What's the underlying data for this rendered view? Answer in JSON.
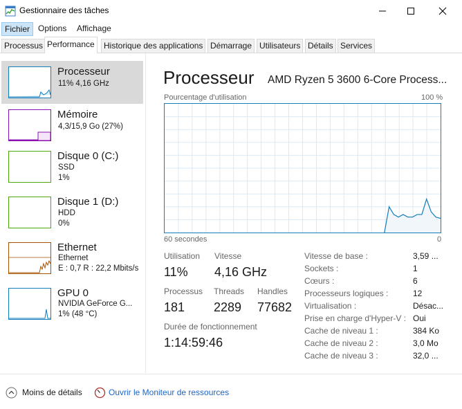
{
  "window": {
    "title": "Gestionnaire des tâches"
  },
  "menu": [
    "Fichier",
    "Options",
    "Affichage"
  ],
  "tabs": [
    "Processus",
    "Performance",
    "Historique des applications",
    "Démarrage",
    "Utilisateurs",
    "Détails",
    "Services"
  ],
  "active_tab": "Performance",
  "sidebar": {
    "items": [
      {
        "title": "Processeur",
        "sub1": "11% 4,16 GHz",
        "sub2": "",
        "color": "#117dbb"
      },
      {
        "title": "Mémoire",
        "sub1": "4,3/15,9 Go (27%)",
        "sub2": "",
        "color": "#8b12ae"
      },
      {
        "title": "Disque 0 (C:)",
        "sub1": "SSD",
        "sub2": "1%",
        "color": "#4da60c"
      },
      {
        "title": "Disque 1 (D:)",
        "sub1": "HDD",
        "sub2": "0%",
        "color": "#4da60c"
      },
      {
        "title": "Ethernet",
        "sub1": "Ethernet",
        "sub2": "E : 0,7 R : 22,2 Mbits/s",
        "color": "#a74f01"
      },
      {
        "title": "GPU 0",
        "sub1": "NVIDIA GeForce G...",
        "sub2": "1% (48 °C)",
        "color": "#117dbb"
      }
    ]
  },
  "main": {
    "title": "Processeur",
    "subtitle": "AMD Ryzen 5 3600 6-Core Process...",
    "graph_label": "Pourcentage d'utilisation",
    "graph_max": "100 %",
    "graph_time": "60 secondes",
    "graph_zero": "0",
    "graph_color": "#117dbb",
    "cpu_usage_history": [
      0,
      0,
      0,
      0,
      0,
      0,
      0,
      0,
      0,
      0,
      0,
      0,
      0,
      0,
      0,
      0,
      0,
      0,
      0,
      0,
      0,
      0,
      0,
      0,
      0,
      0,
      0,
      0,
      0,
      0,
      0,
      0,
      0,
      0,
      0,
      0,
      0,
      0,
      0,
      0,
      0,
      0,
      0,
      0,
      0,
      0,
      0,
      0,
      20,
      14,
      12,
      14,
      12,
      12,
      14,
      14,
      26,
      16,
      12,
      11
    ],
    "stats": {
      "utilisation_label": "Utilisation",
      "utilisation": "11%",
      "vitesse_label": "Vitesse",
      "vitesse": "4,16 GHz",
      "processus_label": "Processus",
      "processus": "181",
      "threads_label": "Threads",
      "threads": "2289",
      "handles_label": "Handles",
      "handles": "77682",
      "uptime_label": "Durée de fonctionnement",
      "uptime": "1:14:59:46"
    },
    "details": [
      {
        "label": "Vitesse de base :",
        "value": "3,59 ..."
      },
      {
        "label": "Sockets :",
        "value": "1"
      },
      {
        "label": "Cœurs :",
        "value": "6"
      },
      {
        "label": "Processeurs logiques :",
        "value": "12"
      },
      {
        "label": "Virtualisation :",
        "value": "Désac..."
      },
      {
        "label": "Prise en charge d'Hyper-V :",
        "value": "Oui"
      },
      {
        "label": "Cache de niveau 1 :",
        "value": "384 Ko"
      },
      {
        "label": "Cache de niveau 2 :",
        "value": "3,0 Mo"
      },
      {
        "label": "Cache de niveau 3 :",
        "value": "32,0 ..."
      }
    ]
  },
  "footer": {
    "less_details": "Moins de détails",
    "open_monitor": "Ouvrir le Moniteur de ressources"
  }
}
